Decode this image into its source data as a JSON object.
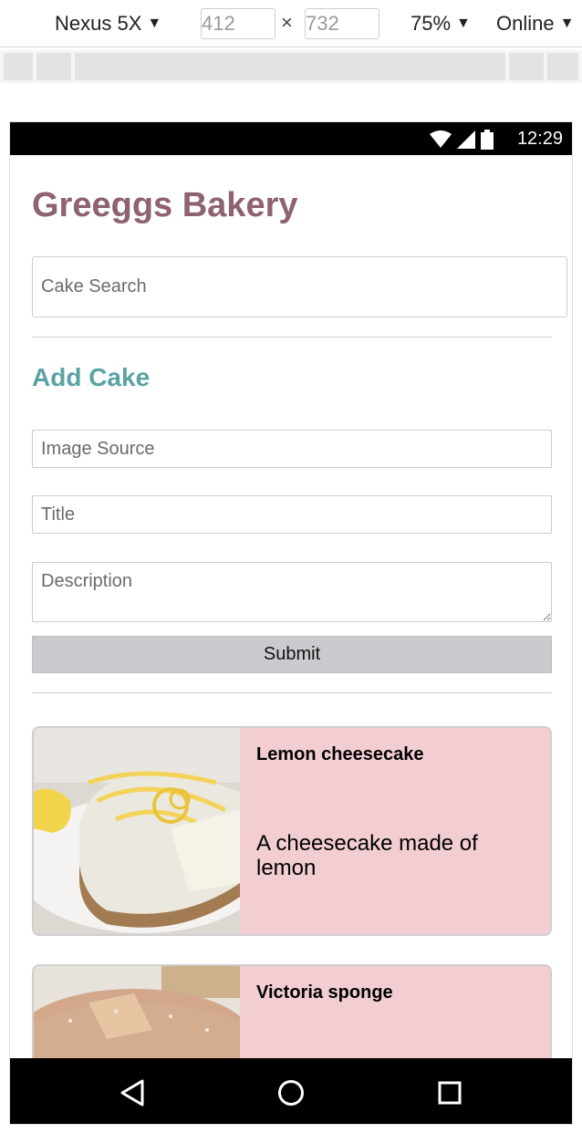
{
  "devtools": {
    "device": "Nexus 5X",
    "width": "412",
    "height": "732",
    "times": "×",
    "zoom": "75%",
    "network": "Online"
  },
  "statusbar": {
    "time": "12:29"
  },
  "app": {
    "title": "Greeggs Bakery",
    "search_placeholder": "Cake Search"
  },
  "add_cake": {
    "heading": "Add Cake",
    "image_source_placeholder": "Image Source",
    "title_placeholder": "Title",
    "description_placeholder": "Description",
    "submit_label": "Submit"
  },
  "cakes": [
    {
      "title": "Lemon cheesecake",
      "description": "A cheesecake made of lemon"
    },
    {
      "title": "Victoria sponge",
      "description": ""
    }
  ],
  "colors": {
    "title": "#8e626e",
    "section": "#5aa2a4",
    "card_bg": "#f2ced3"
  }
}
